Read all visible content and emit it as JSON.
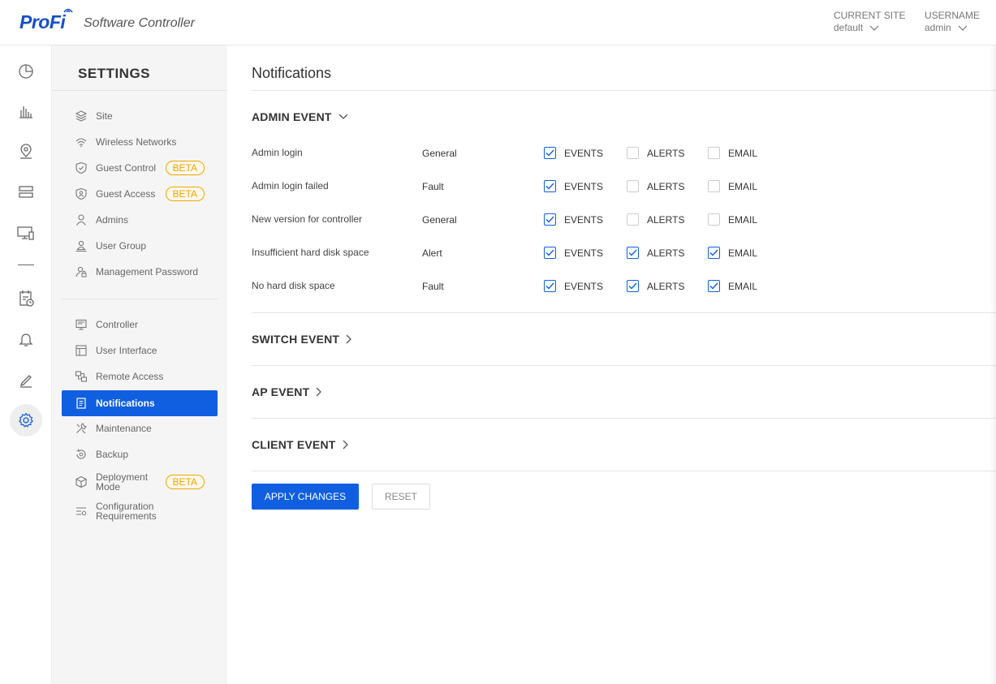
{
  "header": {
    "logo_text": "ProFi",
    "subtitle": "Software Controller",
    "current_site_label": "CURRENT SITE",
    "current_site_value": "default",
    "username_label": "USERNAME",
    "username_value": "admin"
  },
  "rail": {
    "icons": [
      "dashboard-icon",
      "statistics-icon",
      "map-icon",
      "devices-icon",
      "clients-icon",
      "log-icon",
      "alarm-icon",
      "edit-icon",
      "settings-icon"
    ]
  },
  "settings": {
    "title": "SETTINGS",
    "group1": [
      {
        "label": "Site",
        "icon": "layers-icon"
      },
      {
        "label": "Wireless Networks",
        "icon": "wifi-icon"
      },
      {
        "label": "Guest Control",
        "icon": "shield-icon",
        "badge": "BETA"
      },
      {
        "label": "Guest Access",
        "icon": "guest-shield-icon",
        "badge": "BETA"
      },
      {
        "label": "Admins",
        "icon": "user-icon"
      },
      {
        "label": "User Group",
        "icon": "user-group-icon"
      },
      {
        "label": "Management Password",
        "icon": "user-lock-icon"
      }
    ],
    "group2": [
      {
        "label": "Controller",
        "icon": "controller-icon"
      },
      {
        "label": "User Interface",
        "icon": "layout-icon"
      },
      {
        "label": "Remote Access",
        "icon": "remote-icon"
      },
      {
        "label": "Notifications",
        "icon": "notes-icon",
        "active": true
      },
      {
        "label": "Maintenance",
        "icon": "tools-icon"
      },
      {
        "label": "Backup",
        "icon": "backup-icon"
      },
      {
        "label_line1": "Deployment",
        "label_line2": "Mode",
        "icon": "cube-icon",
        "badge": "BETA"
      },
      {
        "label_line1": "Configuration",
        "label_line2": "Requirements",
        "icon": "config-icon"
      }
    ]
  },
  "main": {
    "title": "Notifications",
    "admin_event": {
      "title": "ADMIN EVENT",
      "rows": [
        {
          "name": "Admin login",
          "type": "General",
          "events": true,
          "alerts": false,
          "email": false
        },
        {
          "name": "Admin login failed",
          "type": "Fault",
          "events": true,
          "alerts": false,
          "email": false
        },
        {
          "name": "New version for controller",
          "type": "General",
          "events": true,
          "alerts": false,
          "email": false
        },
        {
          "name": "Insufficient hard disk space",
          "type": "Alert",
          "events": true,
          "alerts": true,
          "email": true
        },
        {
          "name": "No hard disk space",
          "type": "Fault",
          "events": true,
          "alerts": true,
          "email": true
        }
      ],
      "col_events": "EVENTS",
      "col_alerts": "ALERTS",
      "col_email": "EMAIL"
    },
    "switch_event": "SWITCH EVENT",
    "ap_event": "AP EVENT",
    "client_event": "CLIENT EVENT",
    "apply_label": "APPLY CHANGES",
    "reset_label": "RESET"
  },
  "colors": {
    "accent": "#0f5fe0",
    "badge": "#f0a500"
  }
}
